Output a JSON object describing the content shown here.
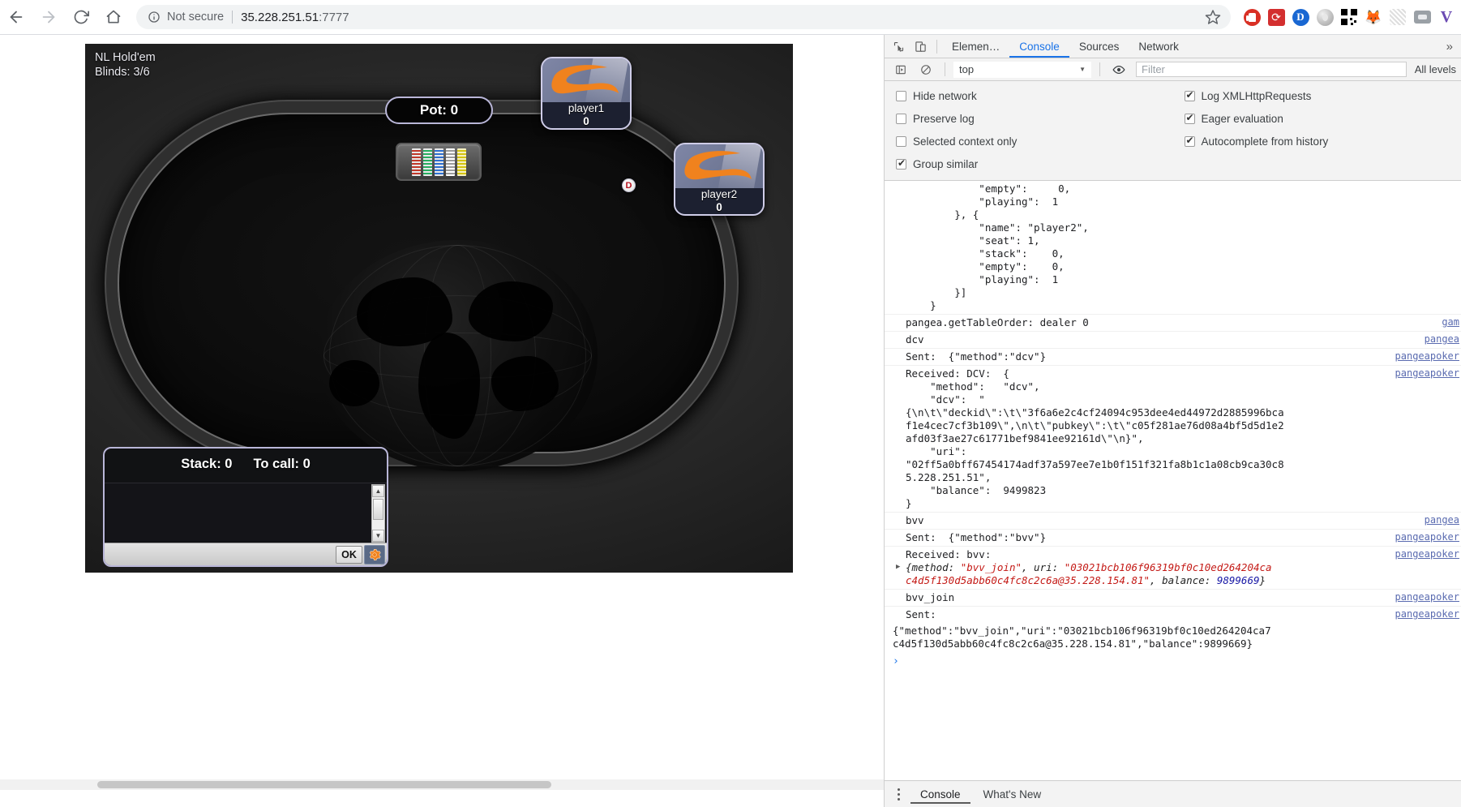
{
  "browser": {
    "back_label": "Back",
    "forward_label": "Forward",
    "reload_label": "Reload",
    "home_label": "Home",
    "security_label": "Not secure",
    "url_host": "35.228.251.51",
    "url_port": ":7777",
    "bookmark_label": "Bookmark this tab",
    "extensions": [
      {
        "name": "adblock-extension-icon",
        "label": "AdBlock"
      },
      {
        "name": "refresh-extension-icon",
        "label": "Auto Refresh"
      },
      {
        "name": "d-extension-icon",
        "label": "D"
      },
      {
        "name": "ring-extension-icon",
        "label": "Ring"
      },
      {
        "name": "qr-code-extension-icon",
        "label": "QR Code"
      },
      {
        "name": "fox-extension-icon",
        "label": "Fox"
      },
      {
        "name": "faded-extension-icon",
        "label": "Disabled extension"
      },
      {
        "name": "grey-box-extension-icon",
        "label": "Grey box"
      },
      {
        "name": "v-extension-icon",
        "label": "V"
      }
    ]
  },
  "poker": {
    "game_type": "NL Hold'em",
    "blinds": "Blinds: 3/6",
    "pot_label": "Pot: 0",
    "dealer_badge": "D",
    "seats": [
      {
        "name": "player1",
        "stack": "0"
      },
      {
        "name": "player2",
        "stack": "0"
      }
    ],
    "chip_colors": [
      "#c0392b",
      "#27ae60",
      "#2d6fd0",
      "#9b9b9b",
      "#d4c412"
    ],
    "action": {
      "stack_label": "Stack: 0",
      "to_call_label": "To call: 0",
      "ok_label": "OK",
      "settings_label": "Settings"
    }
  },
  "devtools": {
    "inspect_label": "Inspect element",
    "device_toolbar_label": "Toggle device toolbar",
    "tabs": [
      {
        "label": "Elemen…",
        "active": false
      },
      {
        "label": "Console",
        "active": true
      },
      {
        "label": "Sources",
        "active": false
      },
      {
        "label": "Network",
        "active": false
      }
    ],
    "more_tabs_label": "»",
    "sidebar_toggle_label": "Show console sidebar",
    "clear_label": "Clear console",
    "context": "top",
    "eye_label": "Create live expression",
    "filter_placeholder": "Filter",
    "levels_label": "All levels",
    "settings_left": [
      {
        "label": "Hide network",
        "checked": false
      },
      {
        "label": "Preserve log",
        "checked": false
      },
      {
        "label": "Selected context only",
        "checked": false
      },
      {
        "label": "Group similar",
        "checked": true
      }
    ],
    "settings_right": [
      {
        "label": "Log XMLHttpRequests",
        "checked": true
      },
      {
        "label": "Eager evaluation",
        "checked": true
      },
      {
        "label": "Autocomplete from history",
        "checked": true
      }
    ],
    "log": [
      {
        "id": "l1",
        "text": "            \"empty\":     0,\n            \"playing\":  1\n        }, {\n            \"name\": \"player2\",\n            \"seat\": 1,\n            \"stack\":    0,\n            \"empty\":    0,\n            \"playing\":  1\n        }]\n    }",
        "source": ""
      },
      {
        "id": "l2",
        "text": "pangea.getTableOrder: dealer 0",
        "source": "gam"
      },
      {
        "id": "l3",
        "text": "dcv",
        "source": "pangea"
      },
      {
        "id": "l4",
        "text": "Sent:  {\"method\":\"dcv\"}",
        "source": "pangeapoker"
      },
      {
        "id": "l5",
        "text": "Received: DCV:  {\n    \"method\":   \"dcv\",\n    \"dcv\":  \"\n{\\n\\t\\\"deckid\\\":\\t\\\"3f6a6e2c4cf24094c953dee4ed44972d2885996bca\nf1e4cec7cf3b109\\\",\\n\\t\\\"pubkey\\\":\\t\\\"c05f281ae76d08a4bf5d5d1e2\nafd03f3ae27c61771bef9841ee92161d\\\"\\n}\",\n    \"uri\":\n\"02ff5a0bff67454174adf37a597ee7e1b0f151f321fa8b1c1a08cb9ca30c8\n5.228.251.51\",\n    \"balance\":  9499823\n}",
        "source": "pangeapoker"
      },
      {
        "id": "l6",
        "text": "bvv",
        "source": "pangea"
      },
      {
        "id": "l7",
        "text": "Sent:  {\"method\":\"bvv\"}",
        "source": "pangeapoker"
      },
      {
        "id": "l8",
        "text": "Received: bvv:",
        "source": "pangeapoker"
      },
      {
        "id": "l9",
        "text": "bvv_join",
        "source": "pangeapoker"
      },
      {
        "id": "l10",
        "text": "Sent:",
        "source": "pangeapoker"
      }
    ],
    "log_bvv_object": {
      "prefix": "{method: ",
      "method": "\"bvv_join\"",
      "mid": ", uri: ",
      "uri_line1": "\"03021bcb106f96319bf0c10ed264204ca",
      "uri_line2": "c4d5f130d5abb60c4fc8c2c6a@35.228.154.81\"",
      "balance_label": ", balance: ",
      "balance": "9899669",
      "suffix": "}"
    },
    "log_sent_join": "{\"method\":\"bvv_join\",\"uri\":\"03021bcb106f96319bf0c10ed264204ca7\nc4d5f130d5abb60c4fc8c2c6a@35.228.154.81\",\"balance\":9899669}",
    "prompt_symbol": "›",
    "status_tabs": [
      {
        "label": "Console",
        "active": true
      },
      {
        "label": "What's New",
        "active": false
      }
    ],
    "more_options_label": "More options"
  }
}
